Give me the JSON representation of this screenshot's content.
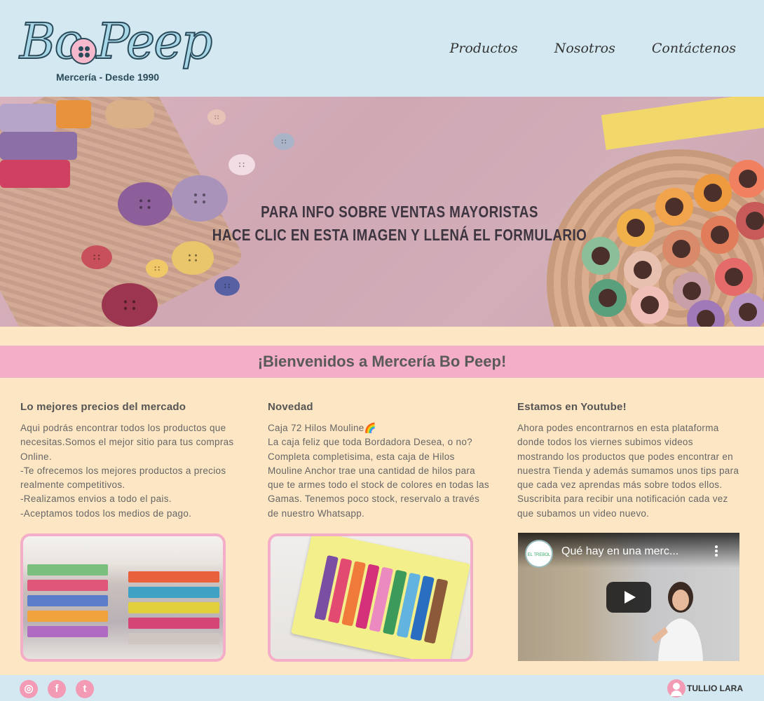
{
  "header": {
    "logo_text": "Bo Peep",
    "logo_subtitle": "Mercería - Desde 1990",
    "nav": [
      {
        "label": "Productos"
      },
      {
        "label": "Nosotros"
      },
      {
        "label": "Contáctenos"
      }
    ]
  },
  "hero": {
    "line1": "PARA INFO SOBRE VENTAS MAYORISTAS",
    "line2": "HACE CLIC EN ESTA IMAGEN Y LLENÁ EL FORMULARIO"
  },
  "welcome": {
    "title": "¡Bienvenidos a Mercería Bo Peep!"
  },
  "columns": [
    {
      "title": "Lo mejores precios del mercado",
      "body": "Aqui podrás encontrar todos los productos que necesitas.Somos el mejor sitio para tus compras Online.\n-Te ofrecemos los mejores productos a precios realmente competitivos.\n-Realizamos envios a todo el pais.\n-Aceptamos todos los medios de pago."
    },
    {
      "title": "Novedad",
      "body": "Caja 72 Hilos Mouline🌈\nLa caja feliz que toda Bordadora Desea, o no? Completa completisima, esta caja de Hilos Mouline Anchor trae una cantidad de hilos para que te armes todo el stock de colores en todas las Gamas. Tenemos poco stock, reservalo a través de nuestro Whatsapp."
    },
    {
      "title": "Estamos en Youtube!",
      "body": "Ahora podes encontrarnos en esta plataforma donde todos los viernes subimos videos mostrando los productos que podes encontrar en nuestra Tienda y además sumamos unos tips para que cada vez aprendas más sobre todos ellos. Suscribita para recibir una notificación cada vez que subamos un video nuevo."
    }
  ],
  "video": {
    "title": "Qué hay en una merc...",
    "channel_badge": "EL TREBOL"
  },
  "footer": {
    "social": [
      {
        "icon": "instagram-icon",
        "glyph": "◎"
      },
      {
        "icon": "facebook-icon",
        "glyph": "f"
      },
      {
        "icon": "twitter-icon",
        "glyph": "t"
      }
    ],
    "user_name": "TULLIO LARA"
  },
  "colors": {
    "header_bg": "#d3e8f0",
    "page_bg": "#fde6c3",
    "accent_pink": "#f5aec8"
  }
}
